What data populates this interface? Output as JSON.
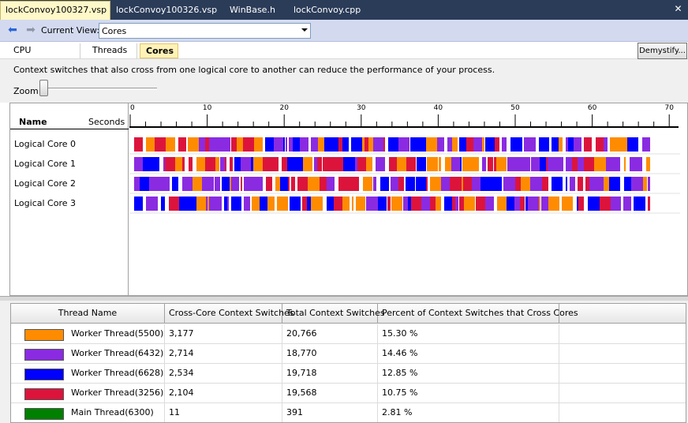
{
  "doc_tabs": [
    "lockConvoy100327.vsp",
    "lockConvoy100326.vsp",
    "WinBase.h",
    "lockConvoy.cpp"
  ],
  "toolbar": {
    "current_view_label": "Current View:",
    "current_view_value": "Cores"
  },
  "view_tabs": [
    "CPU Utilization",
    "Threads",
    "Cores"
  ],
  "active_view_tab": "Cores",
  "demystify_label": "Demystify...",
  "info_text": "Context switches that also cross from one logical core to another can reduce the performance of your process.",
  "zoom_label": "Zoom",
  "timeline": {
    "name_header": "Name",
    "seconds_header": "Seconds",
    "ruler_labels": [
      "0",
      "10",
      "20",
      "30",
      "40",
      "50",
      "60",
      "70"
    ],
    "cores": [
      "Logical Core 0",
      "Logical Core 1",
      "Logical Core 2",
      "Logical Core 3"
    ]
  },
  "table": {
    "columns": [
      "Thread Name",
      "Cross-Core Context Switches",
      "Total Context Switches",
      "Percent of Context Switches that Cross Cores"
    ],
    "rows": [
      {
        "name": "Worker Thread(5500)",
        "cross": "3,177",
        "total": "20,766",
        "percent": "15.30 %",
        "color": "#ff8c00"
      },
      {
        "name": "Worker Thread(6432)",
        "cross": "2,714",
        "total": "18,770",
        "percent": "14.46 %",
        "color": "#8a2be2"
      },
      {
        "name": "Worker Thread(6628)",
        "cross": "2,534",
        "total": "19,718",
        "percent": "12.85 %",
        "color": "#0000ff"
      },
      {
        "name": "Worker Thread(3256)",
        "cross": "2,104",
        "total": "19,568",
        "percent": "10.75 %",
        "color": "#dc143c"
      },
      {
        "name": "Main Thread(6300)",
        "cross": "11",
        "total": "391",
        "percent": "2.81 %",
        "color": "#008000"
      }
    ]
  }
}
